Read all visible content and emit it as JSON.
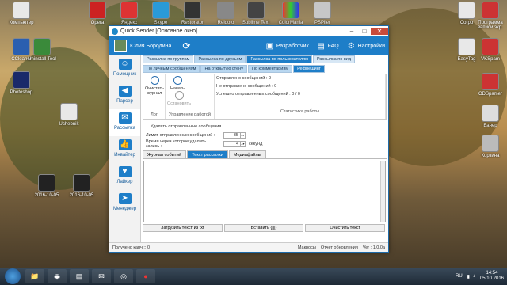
{
  "desktop": {
    "icons_left": [
      {
        "label": "Компьютер"
      },
      {
        "label": "CCleaner"
      },
      {
        "label": "Uninstall Tool"
      },
      {
        "label": "Photoshop"
      },
      {
        "label": "Uchebnik"
      }
    ],
    "icons_top": [
      {
        "label": "Оpera"
      },
      {
        "label": "Яндекс"
      },
      {
        "label": "Skype"
      },
      {
        "label": "Restorator"
      },
      {
        "label": "Reldoto"
      },
      {
        "label": "Sublime Text"
      },
      {
        "label": "ColorMania"
      },
      {
        "label": "PSPiler"
      }
    ],
    "icons_right": [
      {
        "label": "Corpo"
      },
      {
        "label": "Программа записи экр."
      },
      {
        "label": "EasyTag"
      },
      {
        "label": "VKSpam"
      },
      {
        "label": "ODSpamer"
      },
      {
        "label": "Банер"
      },
      {
        "label": "Корзина"
      }
    ],
    "icons_mid": [
      {
        "label": "2016-10-05"
      },
      {
        "label": "2016-10-05"
      }
    ]
  },
  "window": {
    "title": "Quick Sender [Основное окно]",
    "user_name": "Юлия Бородина",
    "header_buttons": [
      {
        "label": "Разработчик",
        "icon": "developer-icon"
      },
      {
        "label": "FAQ",
        "icon": "faq-icon"
      },
      {
        "label": "Настройки",
        "icon": "settings-icon"
      }
    ],
    "sidebar": [
      {
        "label": "Помощник",
        "icon": "helper-icon"
      },
      {
        "label": "Парсер",
        "icon": "parser-icon"
      },
      {
        "label": "Рассылка",
        "icon": "mail-icon"
      },
      {
        "label": "Инвайтер",
        "icon": "like-icon"
      },
      {
        "label": "Лайкер",
        "icon": "heart-icon"
      },
      {
        "label": "Менеджер",
        "icon": "send-icon"
      }
    ],
    "tabs_row1": [
      {
        "label": "Рассылка по группам"
      },
      {
        "label": "Рассылка по друзьям"
      },
      {
        "label": "Рассылка по пользователям"
      },
      {
        "label": "Рассылка по вид"
      }
    ],
    "tabs_row2": [
      {
        "label": "По личным сообщениям"
      },
      {
        "label": "На открытую стену"
      },
      {
        "label": "По комментариям"
      },
      {
        "label": "Рефрешинг"
      }
    ],
    "log_group": {
      "clear_label": "Очистить журнал",
      "caption": "Лог"
    },
    "control_group": {
      "start_label": "Начать",
      "stop_label": "Остановить",
      "caption": "Управление работой"
    },
    "stats_group": {
      "rows": [
        {
          "label": "Отправлено сообщений :",
          "value": "0"
        },
        {
          "label": "Не отправлено сообщений :",
          "value": "0"
        },
        {
          "label": "Успешно отправленных сообщений :",
          "value": "0 / 0"
        }
      ],
      "caption": "Статистика работы"
    },
    "options": {
      "delete_sent": "Удалять отправленные сообщения",
      "limit_label": "Лимит отправленных сообщений :",
      "limit_value": "35",
      "delete_time_label": "Время через которое удалить запись :",
      "delete_time_value": "4",
      "delete_time_unit": "секунд"
    },
    "subtabs": [
      {
        "label": "Журнал событий"
      },
      {
        "label": "Текст рассылки"
      },
      {
        "label": "Медиафайлы"
      }
    ],
    "buttons": [
      {
        "label": "Загрузить текст из txt"
      },
      {
        "label": "Вставить {|||}"
      },
      {
        "label": "Очистить текст"
      }
    ],
    "status": {
      "left": "Получено капч :: 0",
      "macros": "Макросы",
      "report": "Отчет обновления",
      "version": "Ver : 1.0.0a"
    }
  },
  "taskbar": {
    "lang": "RU",
    "time": "14:54",
    "date": "05.10.2016"
  }
}
